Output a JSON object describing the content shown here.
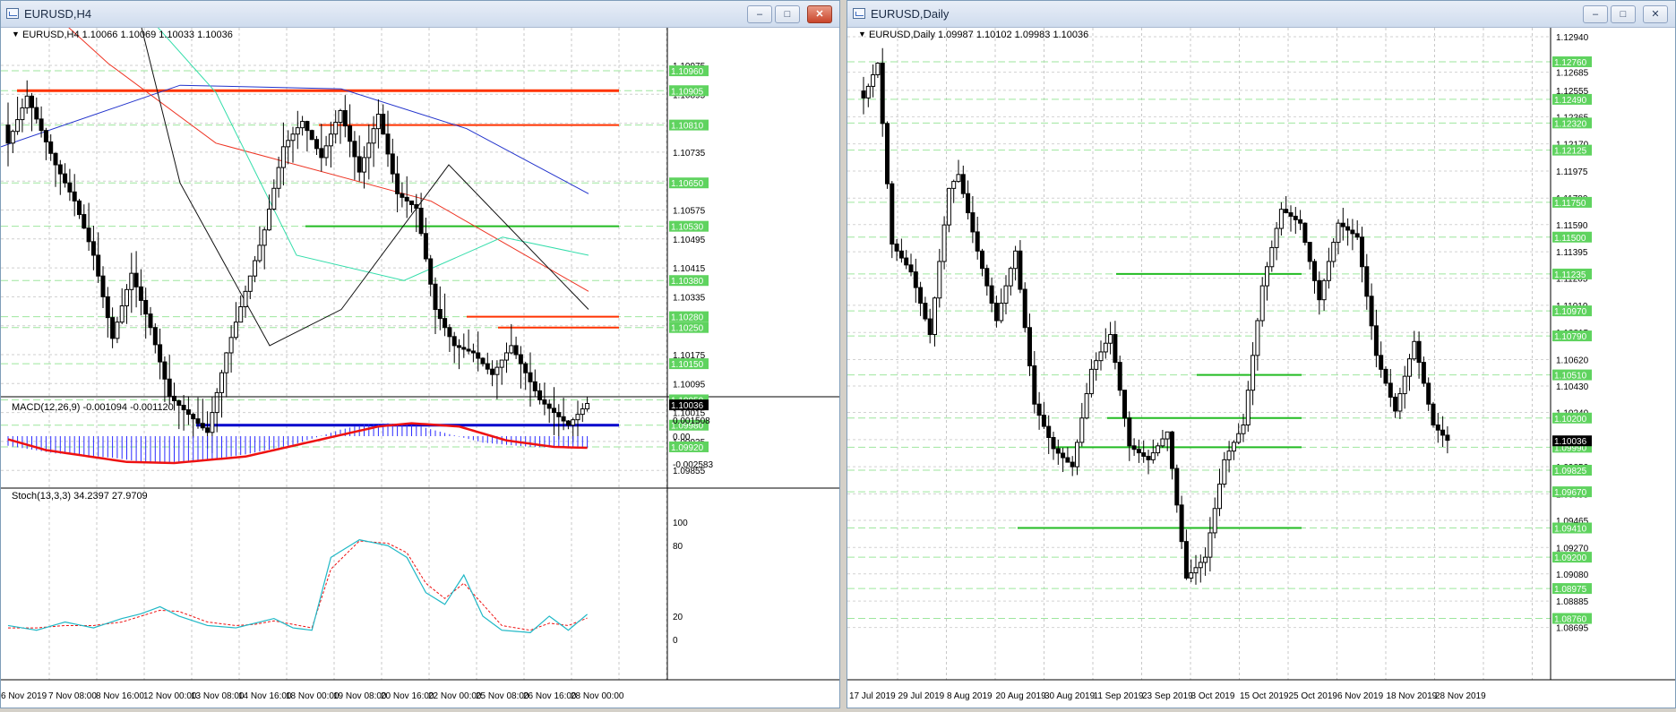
{
  "left_window": {
    "title": "EURUSD,H4",
    "header_text": "EURUSD,H4  1.10066 1.10069 1.10033 1.10036",
    "macd_label": "MACD(12,26,9) -0.001094 -0.001120",
    "stoch_label": "Stoch(13,3,3) 34.2397 27.9709",
    "price_axis": [
      "1.10975",
      "1.10895",
      "1.10815",
      "1.10735",
      "1.10655",
      "1.10575",
      "1.10495",
      "1.10415",
      "1.10335",
      "1.10255",
      "1.10175",
      "1.10095",
      "1.10015",
      "1.09935",
      "1.09855"
    ],
    "level_labels": [
      {
        "text": "1.10960",
        "price": 1.1096
      },
      {
        "text": "1.10905",
        "price": 1.10905
      },
      {
        "text": "1.10810",
        "price": 1.1081
      },
      {
        "text": "1.10650",
        "price": 1.1065
      },
      {
        "text": "1.10530",
        "price": 1.1053
      },
      {
        "text": "1.10380",
        "price": 1.1038
      },
      {
        "text": "1.10280",
        "price": 1.1028
      },
      {
        "text": "1.10250",
        "price": 1.1025
      },
      {
        "text": "1.10150",
        "price": 1.1015
      },
      {
        "text": "1.10050",
        "price": 1.1005
      },
      {
        "text": "1.09980",
        "price": 1.0998
      },
      {
        "text": "1.09920",
        "price": 1.0992
      }
    ],
    "current_price": "1.10036",
    "macd_axis": [
      "0.001508",
      "0.00",
      "-0.002583"
    ],
    "stoch_axis": [
      "100",
      "80",
      "20",
      "0"
    ],
    "time_axis": [
      "6 Nov 2019",
      "7 Nov 08:00",
      "8 Nov 16:00",
      "12 Nov 00:00",
      "13 Nov 08:00",
      "14 Nov 16:00",
      "18 Nov 00:00",
      "19 Nov 08:00",
      "20 Nov 16:00",
      "22 Nov 00:00",
      "25 Nov 08:00",
      "26 Nov 16:00",
      "28 Nov 00:00"
    ]
  },
  "right_window": {
    "title": "EURUSD,Daily",
    "header_text": "EURUSD,Daily  1.09987 1.10102 1.09983 1.10036",
    "price_axis": [
      "1.12940",
      "1.12685",
      "1.12555",
      "1.12365",
      "1.12170",
      "1.11975",
      "1.11780",
      "1.11590",
      "1.11395",
      "1.11205",
      "1.11010",
      "1.10815",
      "1.10620",
      "1.10430",
      "1.10240",
      "1.10045",
      "1.09850",
      "1.09655",
      "1.09465",
      "1.09270",
      "1.09080",
      "1.08885",
      "1.08695"
    ],
    "level_labels": [
      {
        "text": "1.12760",
        "price": 1.1276
      },
      {
        "text": "1.12490",
        "price": 1.1249
      },
      {
        "text": "1.12320",
        "price": 1.1232
      },
      {
        "text": "1.12125",
        "price": 1.12125
      },
      {
        "text": "1.11750",
        "price": 1.1175
      },
      {
        "text": "1.11500",
        "price": 1.115
      },
      {
        "text": "1.11235",
        "price": 1.11235
      },
      {
        "text": "1.10970",
        "price": 1.1097
      },
      {
        "text": "1.10790",
        "price": 1.1079
      },
      {
        "text": "1.10510",
        "price": 1.1051
      },
      {
        "text": "1.10200",
        "price": 1.102
      },
      {
        "text": "1.09990",
        "price": 1.0999
      },
      {
        "text": "1.09825",
        "price": 1.09825
      },
      {
        "text": "1.09670",
        "price": 1.0967
      },
      {
        "text": "1.09410",
        "price": 1.0941
      },
      {
        "text": "1.09200",
        "price": 1.092
      },
      {
        "text": "1.08975",
        "price": 1.08975
      },
      {
        "text": "1.08760",
        "price": 1.0876
      }
    ],
    "current_price": "1.10036",
    "time_axis": [
      "17 Jul 2019",
      "29 Jul 2019",
      "8 Aug 2019",
      "20 Aug 2019",
      "30 Aug 2019",
      "11 Sep 2019",
      "23 Sep 2019",
      "3 Oct 2019",
      "15 Oct 2019",
      "25 Oct 2019",
      "6 Nov 2019",
      "18 Nov 2019",
      "28 Nov 2019"
    ]
  },
  "colors": {
    "resistance": "#ff3300",
    "support_blue": "#0000cc",
    "support_green": "#22bb22",
    "ma_blue": "#2233cc",
    "ma_red": "#ee3322",
    "ma_aqua": "#33ddaa",
    "ma_black": "#111111",
    "macd_hist": "#2b2bff",
    "macd_signal": "#ee1111",
    "stoch_main": "#1fb8c6",
    "stoch_signal": "#ee1111"
  }
}
